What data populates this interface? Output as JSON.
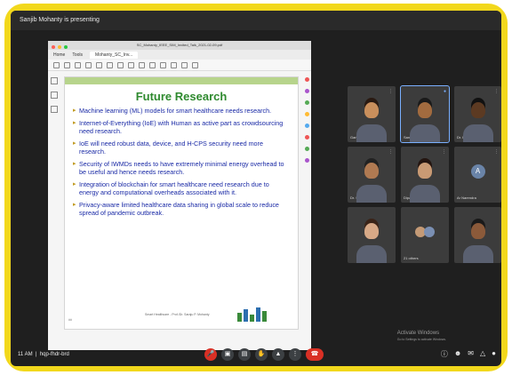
{
  "meeting": {
    "presenting_text": "Sanjib Mohanty is presenting",
    "clock_text": "11 AM",
    "meeting_code": "hqp-fhdr-brd"
  },
  "viewer": {
    "window_title": "SC_Mohanty_IEEE_SIM_Invited_Talk_2021-02-09.pdf",
    "tabs": [
      "Home",
      "Tools",
      "Mohanty_SC_Inv..."
    ]
  },
  "slide": {
    "title": "Future Research",
    "bullets": [
      "Machine learning (ML) models for smart healthcare needs research.",
      "Internet-of-Everything (IoE) with Human as active part as crowdsourcing need research.",
      "IoE will need robust data, device, and H-CPS security need more research.",
      "Security of IWMDs needs to have extremely minimal energy overhead to be useful and hence needs research.",
      "Integration of blockchain for smart healthcare need research due to energy and computational overheads associated with it.",
      "Privacy-aware limited healthcare data sharing in global scale to reduce spread of pandemic outbreak."
    ],
    "footer": "Smart Healthcare - Prof./Dr. Saraju P. Mohanty",
    "slide_number": "##"
  },
  "participants": [
    {
      "name": "Garima Shel",
      "kind": "video",
      "skin": "#c98f5c",
      "hair": "#2a1a12"
    },
    {
      "name": "Sanjib Mohanty",
      "kind": "video",
      "skin": "#a26b3f",
      "hair": "#1a1a1a"
    },
    {
      "name": "Dr. Prabhat Kumar",
      "kind": "video",
      "skin": "#5c3a22",
      "hair": "#111111"
    },
    {
      "name": "Dr. Sandeep garg",
      "kind": "video",
      "skin": "#b07a52",
      "hair": "#222222"
    },
    {
      "name": "Dipanjali ...",
      "kind": "video",
      "skin": "#c99a74",
      "hair": "#241510"
    },
    {
      "name": "Ar Narendra",
      "kind": "avatar",
      "initial": "A"
    },
    {
      "name": "",
      "kind": "video",
      "skin": "#d7a987",
      "hair": "#3a2418"
    },
    {
      "name": "21 others",
      "kind": "others"
    },
    {
      "name": "",
      "kind": "video",
      "skin": "#8b5a3a",
      "hair": "#1a1a1a"
    }
  ],
  "activation": {
    "title": "Activate Windows",
    "subtitle": "Go to Settings to activate Windows."
  },
  "colors": {
    "frame": "#f2d81c",
    "end_call": "#d93025",
    "slide_title": "#2f8a2f",
    "bullet_text": "#1a2aa6"
  },
  "controls": {
    "mic_icon": "mic-icon",
    "camera_icon": "camera-icon",
    "captions_icon": "captions-icon",
    "present_icon": "present-icon",
    "more_icon": "more-icon",
    "end_icon": "end-call-icon"
  }
}
